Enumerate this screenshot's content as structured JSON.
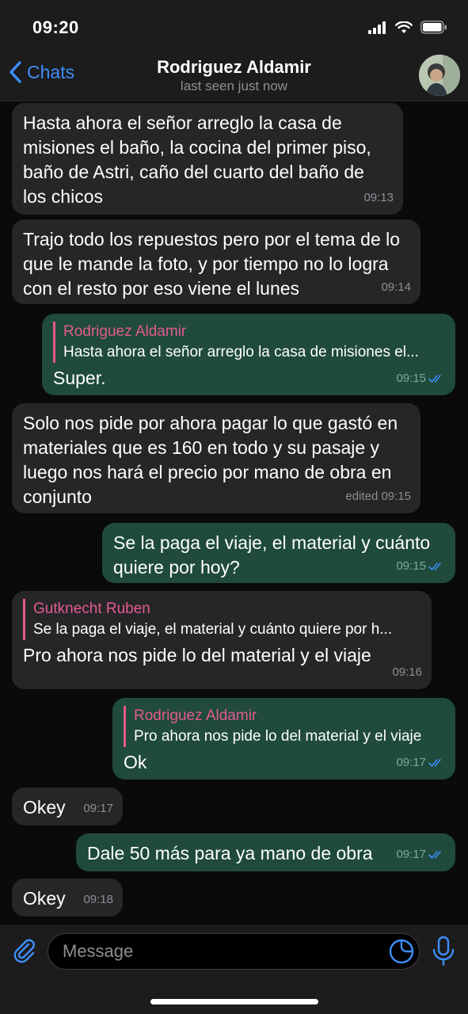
{
  "status": {
    "time": "09:20"
  },
  "header": {
    "back_label": "Chats",
    "title": "Rodriguez Aldamir",
    "subtitle": "last seen just now"
  },
  "messages": [
    {
      "dir": "in",
      "text": "Hasta ahora el señor arreglo la casa de misiones el baño, la cocina del primer piso, baño de Astri, caño del cuarto del baño de los chicos",
      "time": "09:13"
    },
    {
      "dir": "in",
      "text": "Trajo todo los repuestos pero por el tema de lo que le mande la foto, y por tiempo no lo logra con el resto por eso viene el lunes",
      "time": "09:14"
    },
    {
      "dir": "out",
      "reply_name": "Rodriguez Aldamir",
      "reply_text": "Hasta ahora el señor arreglo la casa de misiones el...",
      "text": "Super.",
      "time": "09:15"
    },
    {
      "dir": "in",
      "text": "Solo nos pide por ahora pagar lo que gastó en materiales que es 160 en todo y su pasaje y luego nos hará el precio por mano de obra en conjunto",
      "time": "edited 09:15"
    },
    {
      "dir": "out",
      "text": "Se la paga el viaje, el material y cuánto quiere por hoy?",
      "time": "09:15"
    },
    {
      "dir": "in",
      "reply_name": "Gutknecht Ruben",
      "reply_text": "Se la paga el viaje, el material y cuánto quiere por h...",
      "text": "Pro ahora nos pide lo del material y el viaje",
      "time": "09:16"
    },
    {
      "dir": "out",
      "reply_name": "Rodriguez Aldamir",
      "reply_text": "Pro ahora nos pide lo del material y el viaje",
      "text": "Ok",
      "time": "09:17"
    },
    {
      "dir": "in",
      "text": "Okey",
      "time": "09:17"
    },
    {
      "dir": "out",
      "text": "Dale 50 más para ya mano de obra",
      "time": "09:17"
    },
    {
      "dir": "in",
      "text": "Okey",
      "time": "09:18"
    }
  ],
  "composer": {
    "placeholder": "Message"
  },
  "colors": {
    "accent": "#3e8ef7",
    "incoming": "#262628",
    "outgoing": "#1f4a3c",
    "reply_name": "#e45a8e"
  },
  "icons": [
    "chevron-left-icon",
    "paperclip-icon",
    "sticker-icon",
    "microphone-icon",
    "double-check-icon",
    "signal-icon",
    "wifi-icon",
    "battery-icon"
  ]
}
